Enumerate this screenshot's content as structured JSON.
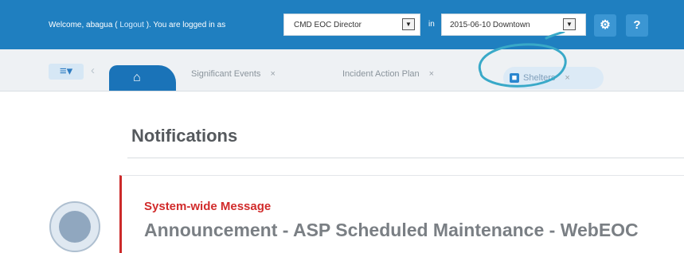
{
  "header": {
    "welcome_prefix": "Welcome, abagua (",
    "logout_label": "Logout",
    "welcome_suffix": "). You are logged in as",
    "position_select": "CMD EOC Director",
    "in_label": "in",
    "incident_select": "2015-06-10 Downtown",
    "icons": [
      "gear-icon",
      "question-icon"
    ]
  },
  "tabs": {
    "home_icon": "home-icon",
    "items": [
      {
        "label": "Significant Events"
      },
      {
        "label": "Incident Action Plan"
      },
      {
        "label": "Shelters",
        "active": true
      }
    ],
    "close_glyph": "×"
  },
  "main": {
    "page_title": "Notifications",
    "message": {
      "title": "System-wide Message",
      "heading": "Announcement - ASP Scheduled Maintenance - WebEOC"
    }
  },
  "colors": {
    "topbar": "#1f7fc0",
    "active_tab": "#1a73b8",
    "alert_red": "#d12b2b",
    "annotation": "#39a9c8"
  }
}
